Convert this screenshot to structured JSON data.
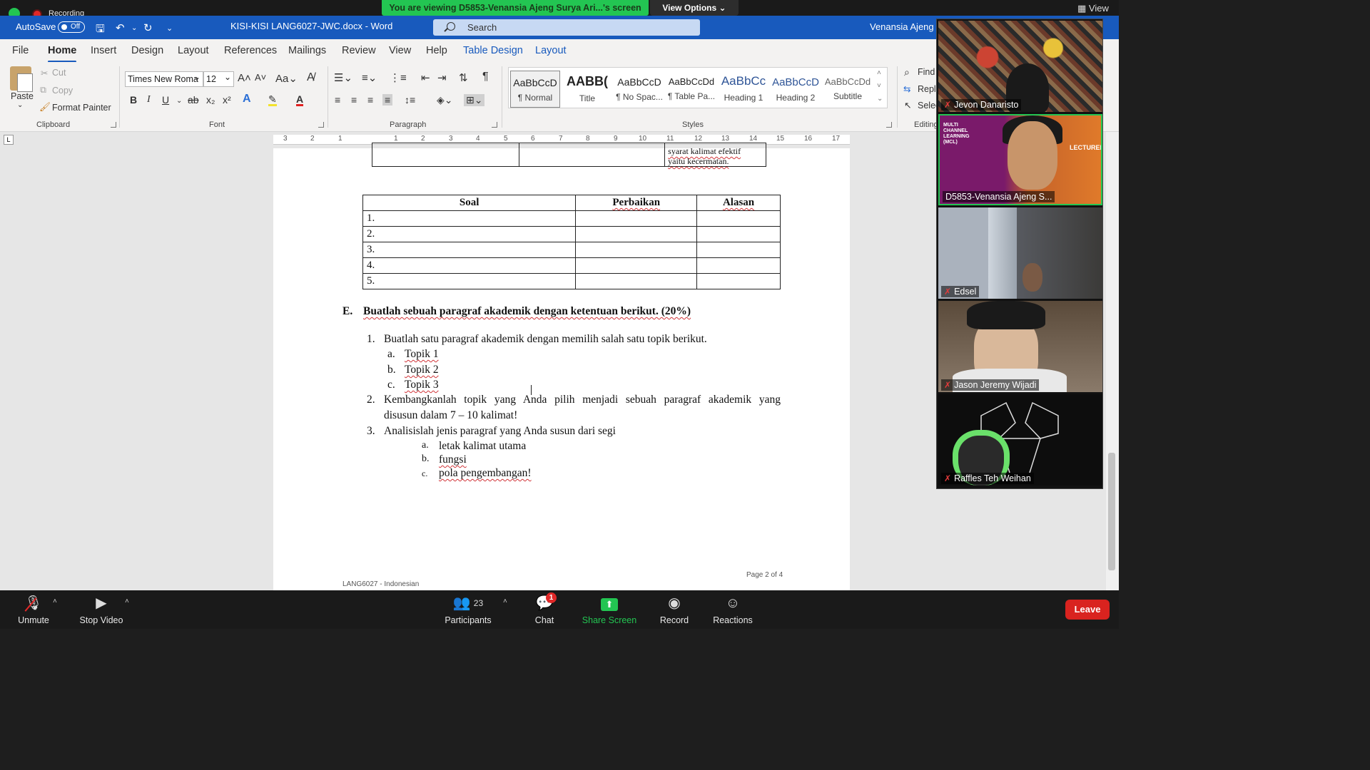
{
  "zoom": {
    "recording_label": "Recording",
    "viewing_banner": "You are viewing D5853-Venansia Ajeng Surya Ari...'s screen",
    "view_options": "View Options",
    "view_button": "View",
    "accent_green": "#23c552",
    "leave_color": "#d9231f",
    "participants": [
      {
        "name": "Jevon Danaristo",
        "muted": true
      },
      {
        "name": "D5853-Venansia Ajeng S...",
        "muted": false,
        "speaking": true,
        "background_text": "MULTI CHANNEL LEARNING (MCL)",
        "badge": "LECTURER"
      },
      {
        "name": "Edsel",
        "muted": true
      },
      {
        "name": "Jason Jeremy Wijadi",
        "muted": true
      },
      {
        "name": "Raffles Teh Weihan",
        "muted": true
      }
    ],
    "toolbar": {
      "unmute": "Unmute",
      "stop_video": "Stop Video",
      "participants": "Participants",
      "participants_count": "23",
      "chat": "Chat",
      "chat_badge": "1",
      "share_screen": "Share Screen",
      "record": "Record",
      "reactions": "Reactions",
      "leave": "Leave"
    }
  },
  "word": {
    "autosave_label": "AutoSave",
    "autosave_state": "Off",
    "doc_title": "KISI-KISI LANG6027-JWC.docx  -  Word",
    "search_placeholder": "Search",
    "user_name": "Venansia Ajeng S",
    "accent_blue": "#185abd",
    "tabs": [
      "File",
      "Home",
      "Insert",
      "Design",
      "Layout",
      "References",
      "Mailings",
      "Review",
      "View",
      "Help",
      "Table Design",
      "Layout"
    ],
    "active_tab": "Home",
    "clipboard": {
      "paste": "Paste",
      "cut": "Cut",
      "copy": "Copy",
      "format_painter": "Format Painter",
      "label": "Clipboard"
    },
    "font": {
      "name": "Times New Roma",
      "size": "12",
      "label": "Font"
    },
    "paragraph": {
      "label": "Paragraph"
    },
    "styles": {
      "label": "Styles",
      "items": [
        {
          "sample": "AaBbCcD",
          "name": "¶ Normal"
        },
        {
          "sample": "AABB(",
          "name": "Title"
        },
        {
          "sample": "AaBbCcD",
          "name": "¶ No Spac..."
        },
        {
          "sample": "AaBbCcDd",
          "name": "¶ Table Pa..."
        },
        {
          "sample": "AaBbCc",
          "name": "Heading 1"
        },
        {
          "sample": "AaBbCcD",
          "name": "Heading 2"
        },
        {
          "sample": "AaBbCcDd",
          "name": "Subtitle"
        }
      ]
    },
    "editing": {
      "find": "Find",
      "replace": "Repl",
      "select": "Selec",
      "label": "Editing"
    },
    "ruler_numbers": [
      "3",
      "2",
      "1",
      "1",
      "2",
      "3",
      "4",
      "5",
      "6",
      "7",
      "8",
      "9",
      "10",
      "11",
      "12",
      "13",
      "14",
      "15",
      "16",
      "17"
    ]
  },
  "document": {
    "prev_table_text_1": "syarat kalimat efektif",
    "prev_table_text_2": "yaitu kecermatan.",
    "table_headers": [
      "Soal",
      "Perbaikan",
      "Alasan"
    ],
    "table_rows": [
      "1.",
      "2.",
      "3.",
      "4.",
      "5."
    ],
    "section_letter": "E.",
    "section_title": "Buatlah sebuah paragraf akademik dengan ketentuan berikut. (20%)",
    "item1_num": "1.",
    "item1_text": "Buatlah satu paragraf akademik dengan memilih salah satu topik berikut.",
    "topics": [
      {
        "letter": "a.",
        "text": "Topik 1"
      },
      {
        "letter": "b.",
        "text": "Topik 2"
      },
      {
        "letter": "c.",
        "text": "Topik 3"
      }
    ],
    "item2_num": "2.",
    "item2_line1": "Kembangkanlah topik yang Anda pilih menjadi sebuah paragraf akademik yang",
    "item2_line2": "disusun dalam 7 – 10 kalimat!",
    "item3_num": "3.",
    "item3_text": "Analisislah jenis paragraf yang Anda susun dari segi",
    "aspects": [
      {
        "letter": "a.",
        "text": "letak kalimat utama"
      },
      {
        "letter": "b.",
        "text": "fungsi"
      },
      {
        "letter": "c.",
        "text": "pola pengembangan!"
      }
    ],
    "page_indicator": "Page 2 of 4",
    "footer_course": "LANG6027 - Indonesian"
  }
}
